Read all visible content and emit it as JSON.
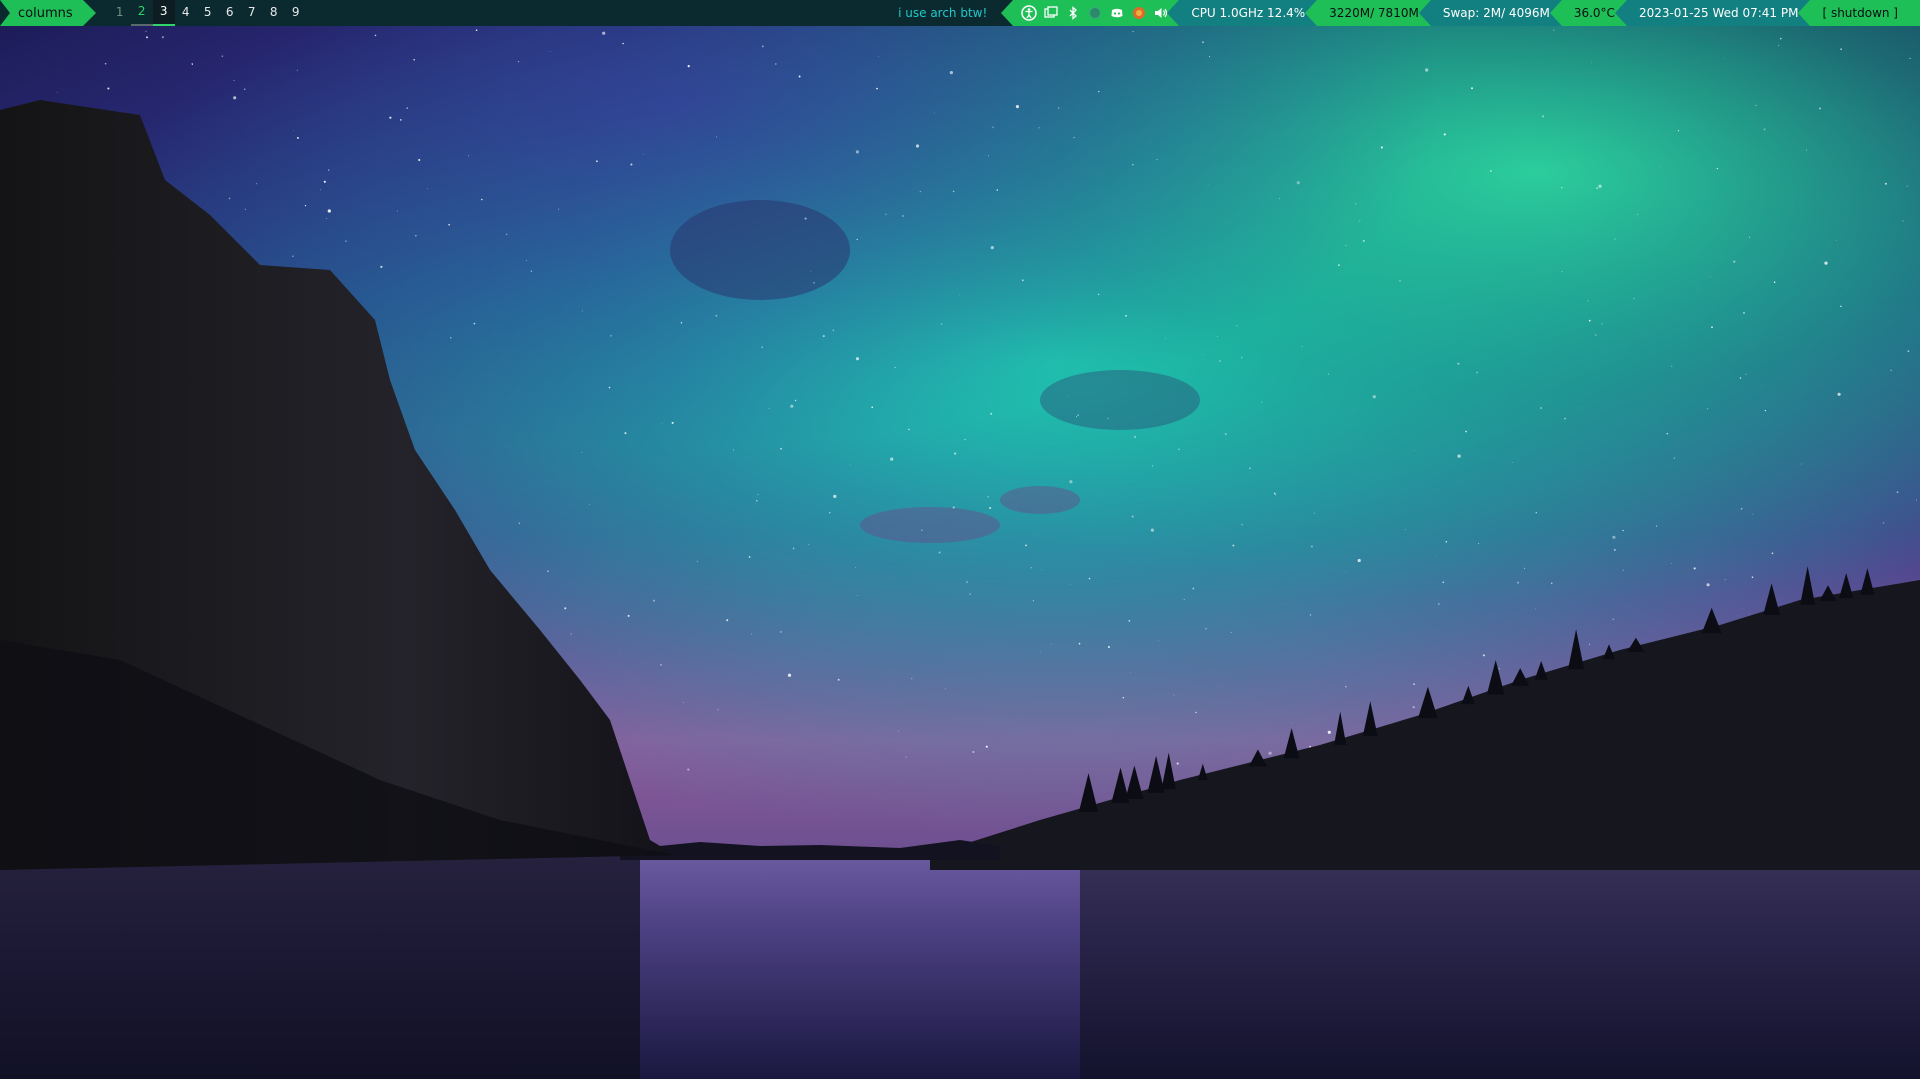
{
  "bar": {
    "layout": "columns",
    "workspaces": [
      {
        "label": "1",
        "state": "dim"
      },
      {
        "label": "2",
        "state": "visible"
      },
      {
        "label": "3",
        "state": "active"
      },
      {
        "label": "4",
        "state": "normal"
      },
      {
        "label": "5",
        "state": "normal"
      },
      {
        "label": "6",
        "state": "normal"
      },
      {
        "label": "7",
        "state": "normal"
      },
      {
        "label": "8",
        "state": "normal"
      },
      {
        "label": "9",
        "state": "normal"
      }
    ],
    "tagline": "i use arch btw!",
    "tray_icons": [
      "accessibility-icon",
      "window-switcher-icon",
      "bluetooth-icon",
      "network-icon",
      "discord-icon",
      "browser-icon",
      "volume-icon"
    ],
    "cpu": "CPU 1.0GHz 12.4%",
    "memory": "3220M/ 7810M",
    "swap": "Swap:  2M/ 4096M",
    "temperature": "36.0°C",
    "clock": "2023-01-25 Wed 07:41 PM",
    "shutdown": "[ shutdown ]"
  },
  "colors": {
    "bar_bg": "#0a2a30",
    "accent_green": "#1fbf58",
    "accent_teal": "#127f80",
    "tagline": "#21c9c9"
  }
}
